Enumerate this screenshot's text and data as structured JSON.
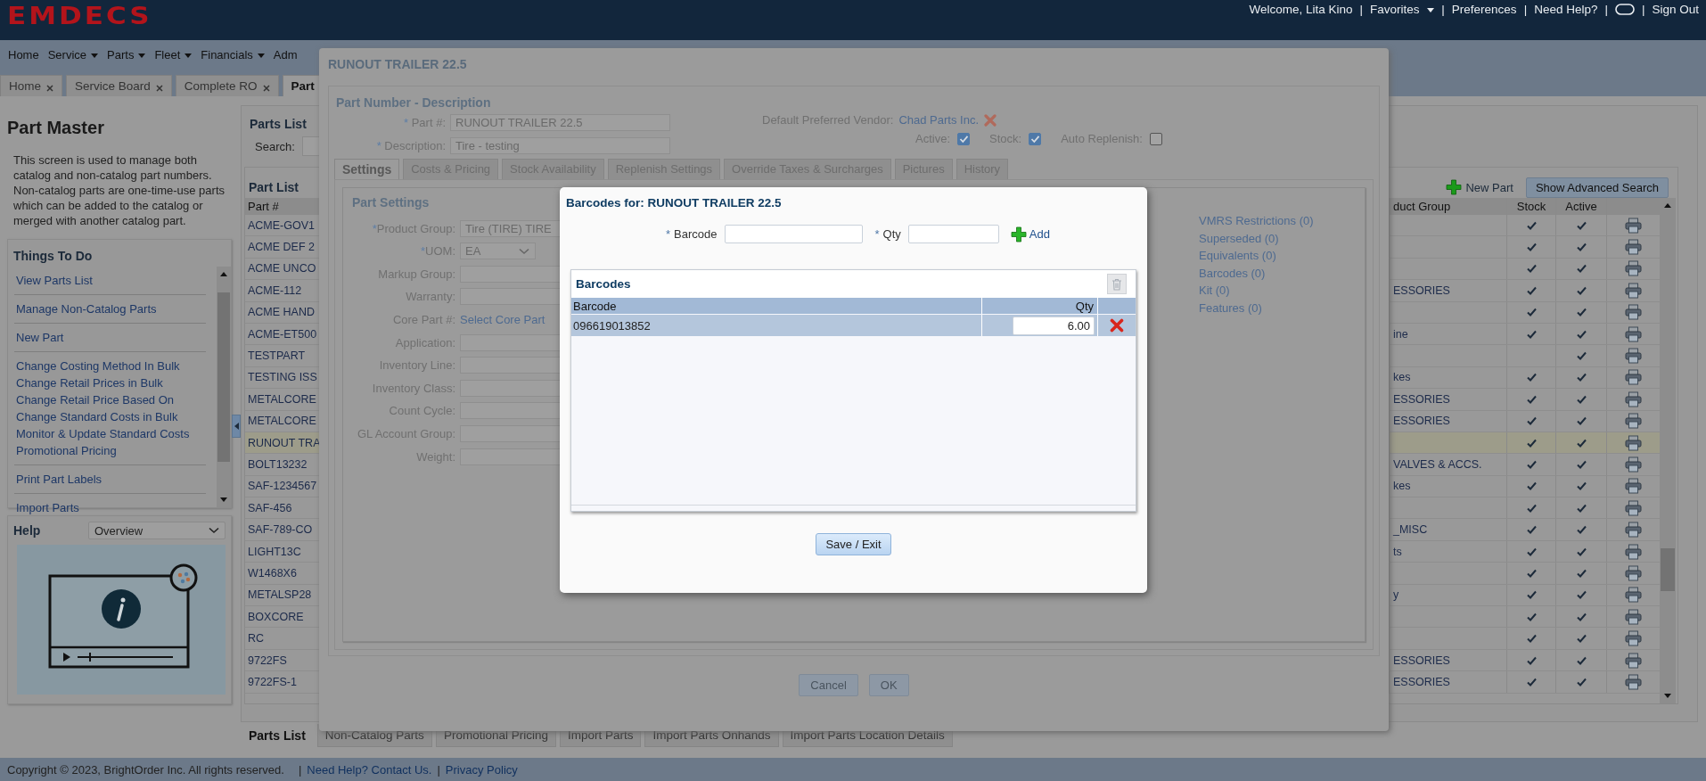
{
  "header": {
    "logo": "EMDECS",
    "separator": "|",
    "links": [
      {
        "kind": "text",
        "label": "Welcome, Lita Kino"
      },
      {
        "kind": "menu",
        "label": "Favorites"
      },
      {
        "kind": "link",
        "label": "Preferences"
      },
      {
        "kind": "link",
        "label": "Need Help?"
      },
      {
        "kind": "chat"
      },
      {
        "kind": "link",
        "label": "Sign Out"
      }
    ]
  },
  "nav": [
    {
      "label": "Home",
      "menu": false
    },
    {
      "label": "Service",
      "menu": true
    },
    {
      "label": "Parts",
      "menu": true
    },
    {
      "label": "Fleet",
      "menu": true
    },
    {
      "label": "Financials",
      "menu": true
    },
    {
      "label": "Adm",
      "menu": false
    }
  ],
  "tabs": [
    {
      "label": "Home",
      "selected": false,
      "closable": true
    },
    {
      "label": "Service Board",
      "selected": false,
      "closable": true
    },
    {
      "label": "Complete RO",
      "selected": false,
      "closable": true
    },
    {
      "label": "Part",
      "selected": true,
      "closable": false
    }
  ],
  "part_master": {
    "title": "Part Master",
    "description": "This screen is used to manage both catalog and non-catalog part numbers. Non-catalog parts are one-time-use parts which can be added to the catalog or merged with another catalog part."
  },
  "things_to_do": {
    "title": "Things To Do",
    "groups": [
      [
        "View Parts List"
      ],
      [
        "Manage Non-Catalog Parts"
      ],
      [
        "New Part"
      ],
      [
        "Change Costing Method In Bulk",
        "Change Retail Prices in Bulk",
        "Change Retail Price Based On",
        "Change Standard Costs in Bulk",
        "Monitor & Update Standard Costs",
        "Promotional Pricing"
      ],
      [
        "Print Part Labels"
      ],
      [
        "Import Parts"
      ]
    ]
  },
  "help": {
    "title": "Help",
    "topic": "Overview"
  },
  "parts_list": {
    "title": "Parts List",
    "search_label": "Search:",
    "list_title": "Part List",
    "new_part": "New Part",
    "advanced_search": "Show Advanced Search",
    "columns": [
      "Part #",
      "duct Group",
      "Stock",
      "Active"
    ],
    "rows": [
      {
        "part": "ACME-GOV1",
        "stock": true,
        "active": true,
        "selected": false
      },
      {
        "part": "ACME DEF 2",
        "stock": true,
        "active": true,
        "selected": false
      },
      {
        "part": "ACME UNCO",
        "stock": true,
        "active": true,
        "selected": false
      },
      {
        "part": "ACME-112",
        "group": "ESSORIES",
        "stock": true,
        "active": true,
        "selected": false
      },
      {
        "part": "ACME HAND",
        "stock": true,
        "active": true,
        "selected": false
      },
      {
        "part": "ACME-ET500",
        "group": "ine",
        "stock": true,
        "active": true,
        "selected": false
      },
      {
        "part": "TESTPART",
        "stock": false,
        "active": true,
        "selected": false
      },
      {
        "part": "TESTING ISS",
        "group": "kes",
        "stock": true,
        "active": true,
        "selected": false
      },
      {
        "part": "METALCORE",
        "group": "ESSORIES",
        "stock": true,
        "active": true,
        "selected": false
      },
      {
        "part": "METALCORE",
        "group": "ESSORIES",
        "stock": true,
        "active": true,
        "selected": false
      },
      {
        "part": "RUNOUT TRA",
        "stock": true,
        "active": true,
        "selected": true
      },
      {
        "part": "BOLT13232",
        "group": "VALVES & ACCS.",
        "stock": true,
        "active": true,
        "selected": false
      },
      {
        "part": "SAF-1234567",
        "group": "kes",
        "stock": true,
        "active": true,
        "selected": false
      },
      {
        "part": "SAF-456",
        "stock": true,
        "active": true,
        "selected": false
      },
      {
        "part": "SAF-789-CO",
        "group": "_MISC",
        "stock": true,
        "active": true,
        "selected": false
      },
      {
        "part": "LIGHT13C",
        "group": "ts",
        "stock": true,
        "active": true,
        "selected": false
      },
      {
        "part": "W1468X6",
        "stock": true,
        "active": true,
        "selected": false
      },
      {
        "part": "METALSP28",
        "group": "y",
        "stock": true,
        "active": true,
        "selected": false
      },
      {
        "part": "BOXCORE",
        "stock": true,
        "active": true,
        "selected": false
      },
      {
        "part": "RC",
        "stock": true,
        "active": true,
        "selected": false
      },
      {
        "part": "9722FS",
        "group": "ESSORIES",
        "stock": true,
        "active": true,
        "selected": false
      },
      {
        "part": "9722FS-1",
        "group": "ESSORIES",
        "stock": true,
        "active": true,
        "selected": false
      }
    ]
  },
  "part_dialog": {
    "title": "RUNOUT TRAILER 22.5",
    "section": "Part Number - Description",
    "required_mark": "*",
    "header_fields": [
      {
        "label": "Part #:",
        "value": "RUNOUT TRAILER 22.5"
      },
      {
        "label": "Description:",
        "value": "Tire - testing"
      }
    ],
    "vendor_label": "Default Preferred Vendor:",
    "vendor": "Chad Parts Inc.",
    "flags": [
      {
        "label": "Active:",
        "checked": true
      },
      {
        "label": "Stock:",
        "checked": true
      },
      {
        "label": "Auto Replenish:",
        "checked": false
      }
    ],
    "tabs": [
      {
        "label": "Settings",
        "selected": true
      },
      {
        "label": "Costs & Pricing",
        "selected": false
      },
      {
        "label": "Stock Availability",
        "selected": false
      },
      {
        "label": "Replenish Settings",
        "selected": false
      },
      {
        "label": "Override Taxes & Surcharges",
        "selected": false
      },
      {
        "label": "Pictures",
        "selected": false
      },
      {
        "label": "History",
        "selected": false
      }
    ],
    "settings_title": "Part Settings",
    "fields": [
      {
        "label": "Product Group:",
        "required": true,
        "kind": "input",
        "value": "Tire (TIRE) TIRE"
      },
      {
        "label": "UOM:",
        "required": true,
        "kind": "select",
        "value": "EA"
      },
      {
        "label": "Markup Group:",
        "required": false,
        "kind": "input"
      },
      {
        "label": "Warranty:",
        "required": false,
        "kind": "input"
      },
      {
        "label": "Core Part #:",
        "required": false,
        "kind": "link",
        "value": "Select Core Part"
      },
      {
        "label": "Application:",
        "required": false,
        "kind": "input"
      },
      {
        "label": "Inventory Line:",
        "required": false,
        "kind": "input"
      },
      {
        "label": "Inventory Class:",
        "required": false,
        "kind": "input"
      },
      {
        "label": "Count Cycle:",
        "required": false,
        "kind": "input"
      },
      {
        "label": "GL Account Group:",
        "required": false,
        "kind": "input"
      },
      {
        "label": "Weight:",
        "required": false,
        "kind": "input"
      }
    ],
    "links": [
      "VMRS Restrictions (0)",
      "Superseded (0)",
      "Equivalents (0)",
      "Barcodes (0)",
      "Kit (0)",
      "Features (0)"
    ],
    "buttons": [
      "Cancel",
      "OK"
    ]
  },
  "barcode_dialog": {
    "title": "Barcodes for: RUNOUT TRAILER 22.5",
    "required_mark": "*",
    "barcode_label": "Barcode",
    "qty_label": "Qty",
    "add": "Add",
    "grid_title": "Barcodes",
    "columns": [
      "Barcode",
      "Qty"
    ],
    "rows": [
      {
        "barcode": "096619013852",
        "qty": "6.00",
        "selected": true
      }
    ],
    "save": "Save / Exit"
  },
  "bottom_tabs": [
    {
      "label": "Parts List",
      "selected": true
    },
    {
      "label": "Non-Catalog Parts",
      "selected": false
    },
    {
      "label": "Promotional Pricing",
      "selected": false
    },
    {
      "label": "Import Parts",
      "selected": false
    },
    {
      "label": "Import Parts Onhands",
      "selected": false
    },
    {
      "label": "Import Parts Location Details",
      "selected": false
    }
  ],
  "footer": {
    "copyright": "Copyright © 2023, BrightOrder Inc. All rights reserved.",
    "separator": "|",
    "links": [
      "Need Help? Contact Us.",
      "Privacy Policy"
    ]
  }
}
